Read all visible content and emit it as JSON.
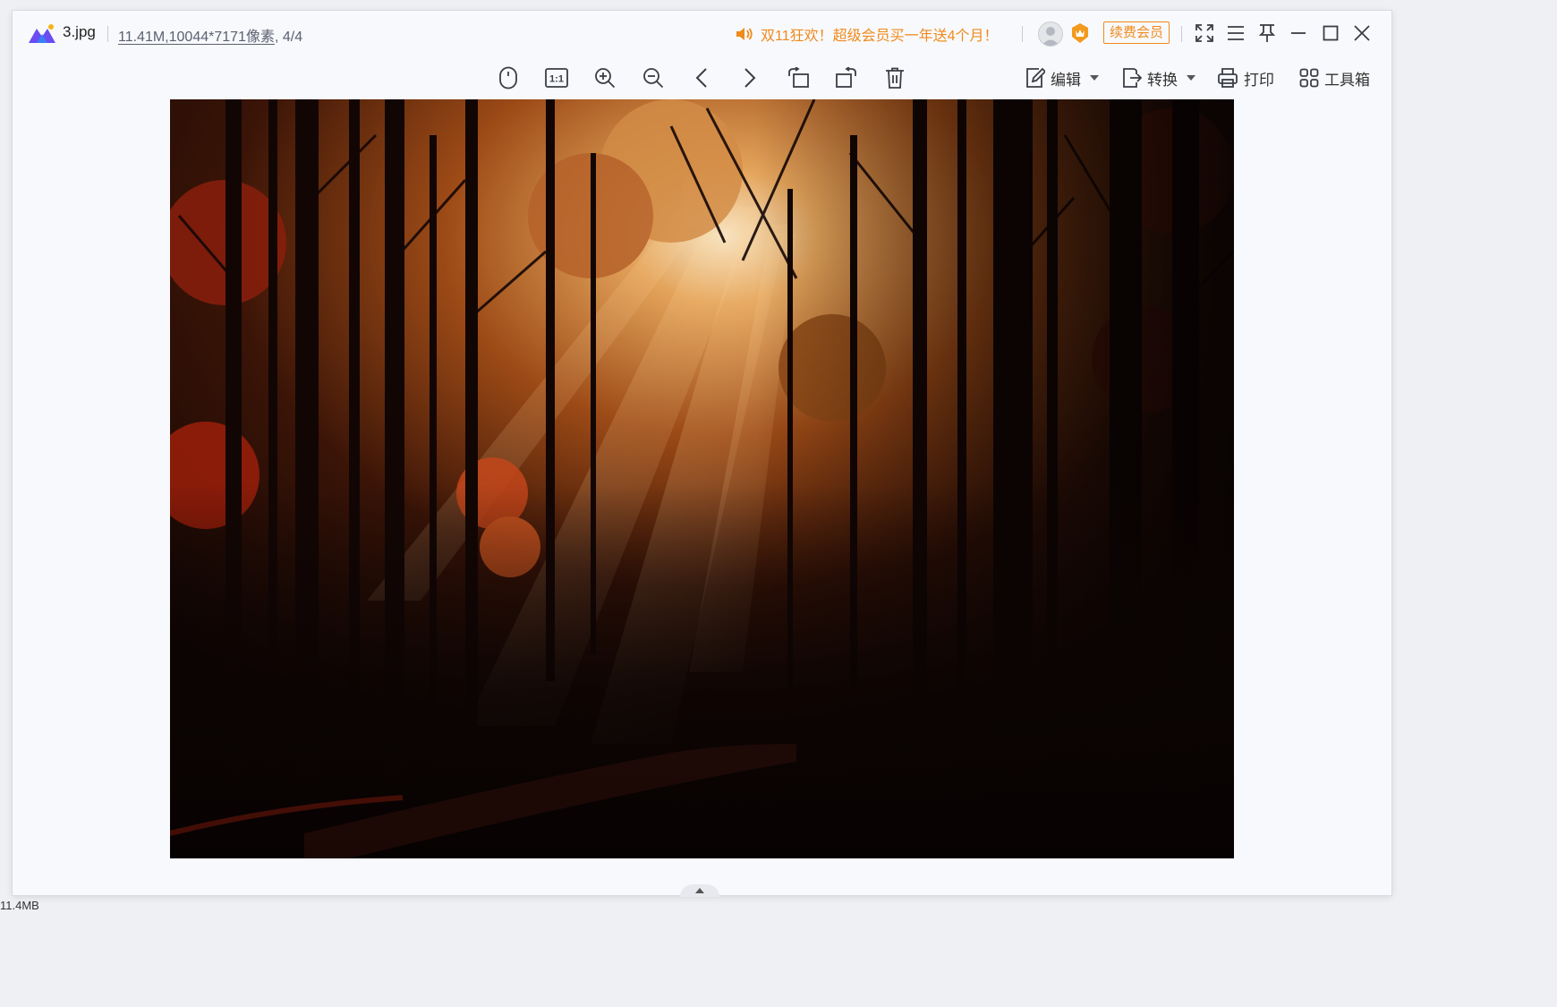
{
  "titlebar": {
    "filename": "3.jpg",
    "file_size": "11.41M",
    "dimensions": ",10044*7171像素",
    "position": ", 4/4",
    "promo_text": "双11狂欢！超级会员买一年送4个月！",
    "renew_label": "续费会员"
  },
  "toolbar": {
    "icons": [
      "mouse-icon",
      "actual-size-icon",
      "zoom-in-icon",
      "zoom-out-icon",
      "previous-icon",
      "next-icon",
      "rotate-left-icon",
      "rotate-right-icon",
      "delete-icon"
    ],
    "actual_size_label": "1:1",
    "edit_label": "编辑",
    "convert_label": "转换",
    "print_label": "打印",
    "toolbox_label": "工具箱"
  },
  "status": {
    "peek_text": "11.4MB"
  },
  "colors": {
    "accent": "#f08a1c",
    "window_bg": "#f8f9fc",
    "icon": "#3a3d45",
    "logo_purple": "#6a4cf0",
    "logo_blue": "#3b7df5"
  }
}
